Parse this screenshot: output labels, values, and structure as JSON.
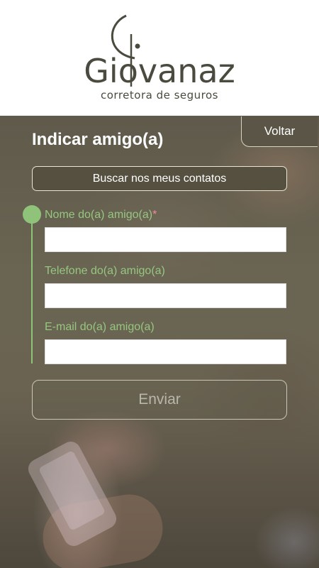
{
  "brand": {
    "name": "Giovanaz",
    "tagline": "corretora de seguros"
  },
  "nav": {
    "back_label": "Voltar"
  },
  "page": {
    "title": "Indicar amigo(a)"
  },
  "actions": {
    "contacts_label": "Buscar nos meus contatos",
    "submit_label": "Enviar"
  },
  "form": {
    "name_label": "Nome do(a) amigo(a)",
    "name_required_mark": "*",
    "name_value": "",
    "phone_label": "Telefone do(a) amigo(a)",
    "phone_value": "",
    "email_label": "E-mail do(a) amigo(a)",
    "email_value": ""
  },
  "colors": {
    "accent_green": "#8fc37a",
    "brand_text": "#4a4a3e",
    "required_mark": "#f08a9a"
  }
}
